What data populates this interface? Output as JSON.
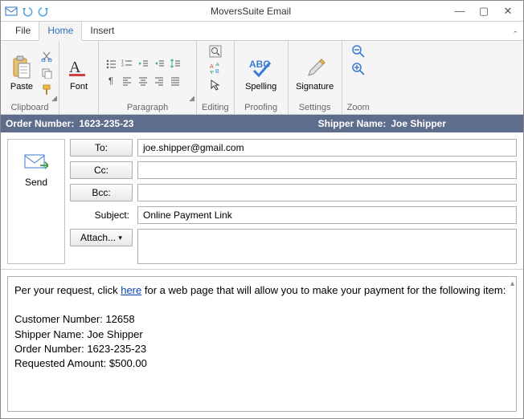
{
  "titlebar": {
    "title": "MoversSuite Email"
  },
  "tabs": {
    "file": "File",
    "home": "Home",
    "insert": "Insert"
  },
  "ribbon": {
    "clipboard": {
      "label": "Clipboard",
      "paste": "Paste"
    },
    "font": {
      "label": "Font"
    },
    "paragraph": {
      "label": "Paragraph"
    },
    "editing": {
      "label": "Editing"
    },
    "proofing": {
      "label": "Proofing",
      "spelling": "Spelling"
    },
    "settings": {
      "label": "Settings",
      "signature": "Signature"
    },
    "zoom": {
      "label": "Zoom"
    }
  },
  "infobar": {
    "order_label": "Order Number:",
    "order_value": "1623-235-23",
    "shipper_label": "Shipper Name:",
    "shipper_value": "Joe Shipper"
  },
  "header": {
    "send": "Send",
    "to_label": "To:",
    "to_value": "joe.shipper@gmail.com",
    "cc_label": "Cc:",
    "cc_value": "",
    "bcc_label": "Bcc:",
    "bcc_value": "",
    "subject_label": "Subject:",
    "subject_value": "Online Payment Link",
    "attach_label": "Attach..."
  },
  "body": {
    "line1_pre": "Per your request, click ",
    "link": "here",
    "line1_post": " for a web page that will allow you to make your payment for the following item:",
    "cust_label": "Customer Number:",
    "cust_value": "12658",
    "shipper_label": "Shipper Name:",
    "shipper_value": "Joe Shipper",
    "order_label": "Order Number:",
    "order_value": "1623-235-23",
    "amount_label": "Requested Amount:",
    "amount_value": "$500.00"
  }
}
